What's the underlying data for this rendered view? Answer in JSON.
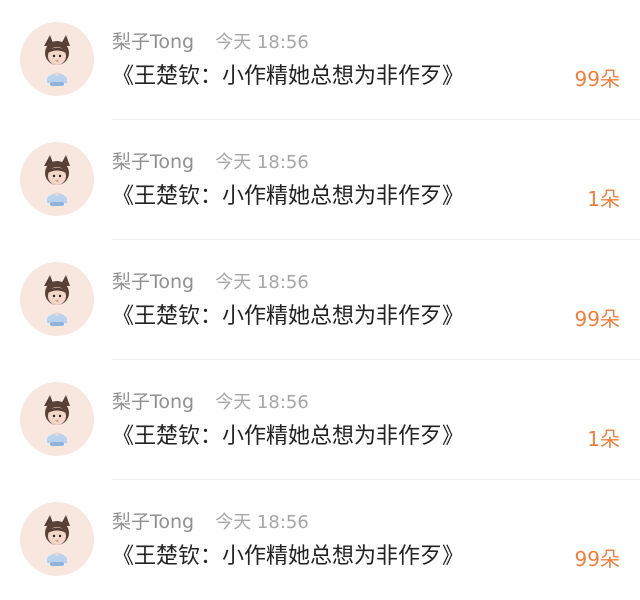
{
  "messages": [
    {
      "name": "梨子Tong",
      "time": "今天 18:56",
      "text": "《王楚钦：小作精她总想为非作歹》",
      "gift": "99朵",
      "avatar_icon": "chibi-girl-avatar"
    },
    {
      "name": "梨子Tong",
      "time": "今天 18:56",
      "text": "《王楚钦：小作精她总想为非作歹》",
      "gift": "1朵",
      "avatar_icon": "chibi-girl-avatar"
    },
    {
      "name": "梨子Tong",
      "time": "今天 18:56",
      "text": "《王楚钦：小作精她总想为非作歹》",
      "gift": "99朵",
      "avatar_icon": "chibi-girl-avatar"
    },
    {
      "name": "梨子Tong",
      "time": "今天 18:56",
      "text": "《王楚钦：小作精她总想为非作歹》",
      "gift": "1朵",
      "avatar_icon": "chibi-girl-avatar"
    },
    {
      "name": "梨子Tong",
      "time": "今天 18:56",
      "text": "《王楚钦：小作精她总想为非作歹》",
      "gift": "99朵",
      "avatar_icon": "chibi-girl-avatar"
    }
  ],
  "colors": {
    "name": "#8f8f8f",
    "time": "#a6a6a6",
    "message": "#222222",
    "gift": "#f07f3c",
    "avatar_bg": "#f8e7df"
  }
}
